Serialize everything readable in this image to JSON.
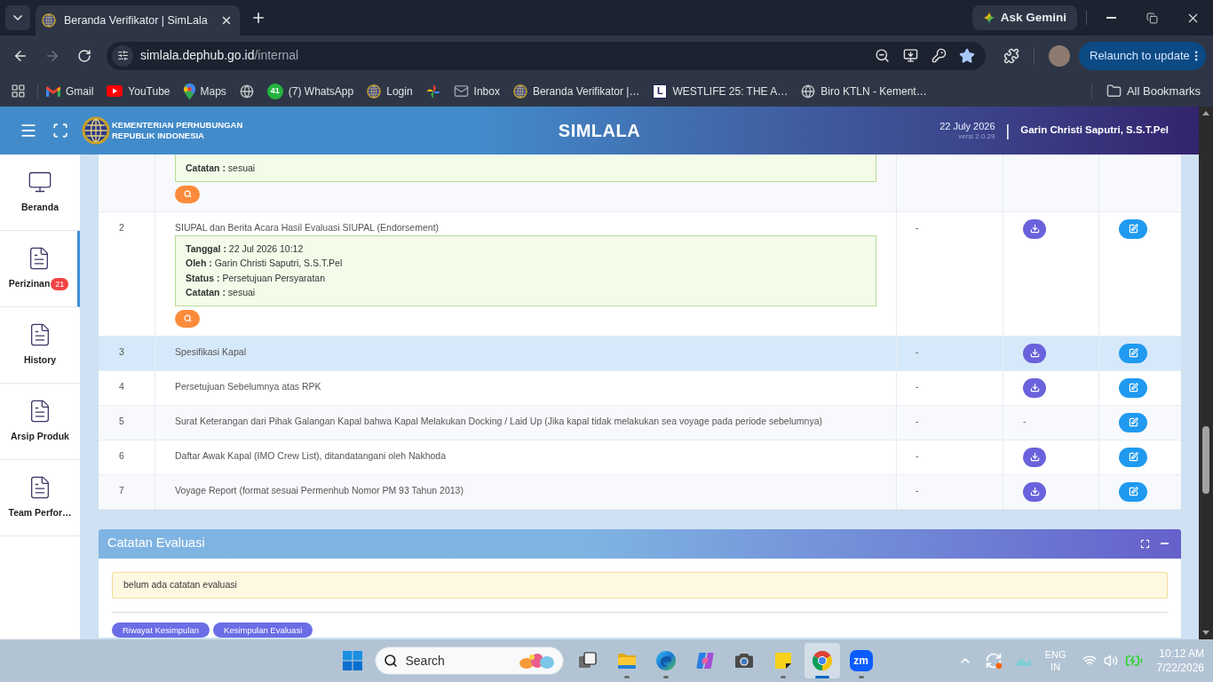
{
  "browser": {
    "tabs": [
      {
        "title": "Beranda Verifikator | SimLala",
        "selected": true
      }
    ],
    "ask_button": "Ask Gemini",
    "back": {
      "disabled": false
    },
    "forward": {
      "disabled": true
    },
    "address": {
      "host": "simlala.dephub.go.id",
      "path": "/internal"
    },
    "bookmarked": true,
    "relaunch_button": "Relaunch to update",
    "bookmarks": [
      {
        "kind": "gmail",
        "label": "Gmail"
      },
      {
        "kind": "youtube",
        "label": "YouTube"
      },
      {
        "kind": "maps",
        "label": "Maps"
      },
      {
        "kind": "globe"
      },
      {
        "kind": "count",
        "badge": "41",
        "label": "(7) WhatsApp"
      },
      {
        "kind": "emblem",
        "label": "Login"
      },
      {
        "kind": "pinwheel"
      },
      {
        "kind": "mail",
        "label": "Inbox"
      },
      {
        "kind": "emblem",
        "label": "Beranda Verifikator |…"
      },
      {
        "kind": "letter",
        "letter": "L",
        "label": "WESTLIFE 25: THE A…"
      },
      {
        "kind": "globe",
        "label": "Biro KTLN - Kement…"
      }
    ],
    "all_bookmarks": "All Bookmarks"
  },
  "app": {
    "header": {
      "org": [
        "KEMENTERIAN PERHUBUNGAN",
        "REPUBLIK INDONESIA"
      ],
      "title": "SIMLALA",
      "date": "22 July 2026",
      "version": "versi 2.0.29",
      "separator": "|",
      "user": "Garin Christi Saputri, S.S.T.Pel"
    },
    "sidebar": {
      "items": [
        {
          "kind": "monitor",
          "label": "Beranda",
          "selected": false
        },
        {
          "kind": "document",
          "label": "Perizinan",
          "badge": "21",
          "selected": true
        },
        {
          "kind": "document",
          "label": "History",
          "selected": false
        },
        {
          "kind": "document",
          "label": "Arsip Produk",
          "selected": false
        },
        {
          "kind": "document",
          "label": "Team Perfor…",
          "selected": false
        }
      ]
    },
    "documents": {
      "rows": [
        {
          "details": [
            "**Catatan :** sesuai"
          ],
          "preview": true,
          "download": false,
          "edit": false,
          "highlighted": false
        },
        {
          "no": "2",
          "title": "SIUPAL dan Berita Acara Hasil Evaluasi SIUPAL (Endorsement)",
          "details": [
            "**Tanggal :** 22 Jul 2026 10:12",
            "**Oleh :** Garin Christi Saputri, S.S.T.Pel",
            "**Status :** Persetujuan Persyaratan",
            "**Catatan :** sesuai"
          ],
          "preview": true,
          "column_3": "-",
          "download": true,
          "edit": true,
          "highlighted": false
        },
        {
          "no": "3",
          "title": "Spesifikasi Kapal",
          "preview": false,
          "column_3": "-",
          "download": true,
          "edit": true,
          "highlighted": true
        },
        {
          "no": "4",
          "title": "Persetujuan Sebelumnya atas RPK",
          "preview": false,
          "column_3": "-",
          "download": true,
          "edit": true,
          "highlighted": false
        },
        {
          "no": "5",
          "title": "Surat Keterangan dari Pihak Galangan Kapal bahwa Kapal Melakukan Docking / Laid Up (Jika kapal tidak melakukan sea voyage pada periode sebelumnya)",
          "preview": false,
          "column_3": "-",
          "download": false,
          "column_4": "-",
          "edit": true,
          "highlighted": false
        },
        {
          "no": "6",
          "title": "Daftar Awak Kapal (IMO Crew List), ditandatangani oleh Nakhoda",
          "preview": false,
          "column_3": "-",
          "download": true,
          "edit": true,
          "highlighted": false
        },
        {
          "no": "7",
          "title": "Voyage Report (format sesuai Permenhub Nomor PM 93 Tahun 2013)",
          "preview": false,
          "column_3": "-",
          "download": true,
          "edit": true,
          "highlighted": false
        }
      ]
    },
    "evaluation_notes": {
      "title": "Catatan Evaluasi",
      "message": "belum ada catatan evaluasi",
      "buttons": [
        "Riwayat Kesimpulan",
        "Kesimpulan Evaluasi"
      ]
    }
  },
  "taskbar": {
    "search": {
      "placeholder": "Search"
    },
    "apps": [
      {
        "kind": "task-view",
        "running": false,
        "active": false
      },
      {
        "kind": "files",
        "running": true,
        "active": false
      },
      {
        "kind": "edge",
        "running": true,
        "active": false
      },
      {
        "kind": "copilot",
        "running": false,
        "active": false
      },
      {
        "kind": "camera",
        "running": false,
        "active": false
      },
      {
        "kind": "notes",
        "running": true,
        "active": false
      },
      {
        "kind": "chrome",
        "running": true,
        "active": true
      },
      {
        "kind": "zoom",
        "label": "zm",
        "running": true,
        "active": false
      }
    ],
    "language": [
      "ENG",
      "IN"
    ],
    "clock": {
      "time": "10:12 AM",
      "date": "7/22/2026"
    }
  }
}
